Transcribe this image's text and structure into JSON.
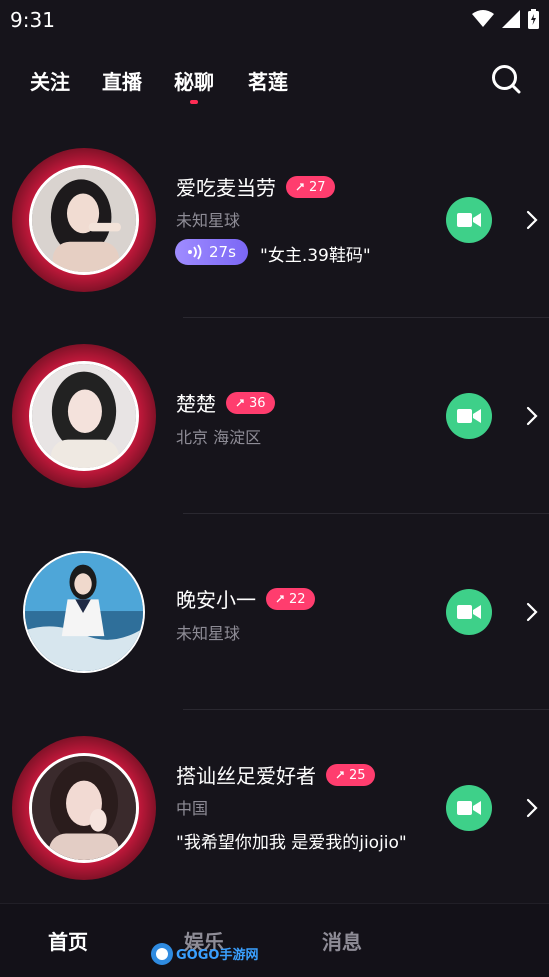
{
  "status_bar": {
    "time": "9:31"
  },
  "top_nav": {
    "tabs": [
      "关注",
      "直播",
      "秘聊",
      "茗莲"
    ],
    "active_tab": "秘聊"
  },
  "users": [
    {
      "name": "爱吃麦当劳",
      "badge": "27",
      "location": "未知星球",
      "voice_duration": "27s",
      "intro": "\"女主.39鞋码\"",
      "online_ring": true
    },
    {
      "name": "楚楚",
      "badge": "36",
      "location": "北京 海淀区",
      "online_ring": true
    },
    {
      "name": "晚安小一",
      "badge": "22",
      "location": "未知星球",
      "online_ring": false
    },
    {
      "name": "搭讪丝足爱好者",
      "badge": "25",
      "location": "中国",
      "intro": "\"我希望你加我 是爱我的jiojio\"",
      "online_ring": true
    }
  ],
  "bottom_nav": {
    "tabs": [
      "首页",
      "娱乐",
      "消息"
    ],
    "active_tab": "首页"
  },
  "watermark": "GOGO手游网",
  "colors": {
    "accent": "#ff2d55",
    "badge": "#ff3d6e",
    "call": "#3ed089",
    "voice": "#8f7bff",
    "background": "#16141b"
  }
}
